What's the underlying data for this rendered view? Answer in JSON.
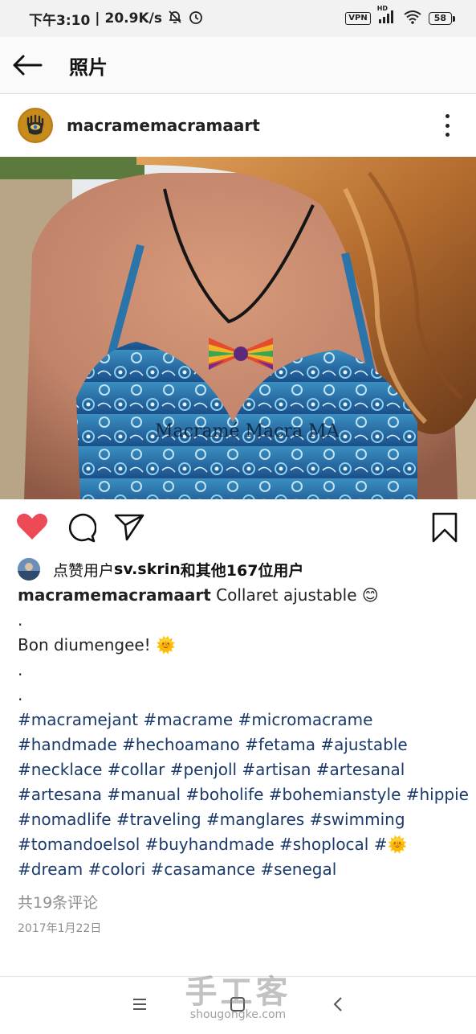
{
  "status_bar": {
    "time": "下午3:10",
    "network_speed": "20.9K/s",
    "vpn": "VPN",
    "hd": "HD",
    "battery": "58"
  },
  "app_bar": {
    "title": "照片"
  },
  "post": {
    "username": "macramemacramaart",
    "photo_watermark": "Macramé Macra MA",
    "likes": {
      "prefix": "点赞用户 ",
      "user": "sv.skrin",
      "mid": "和",
      "others": "其他167位用户"
    },
    "caption": {
      "user": "macramemacramaart",
      "text": " Collaret ajustable 😊",
      "line2": ".",
      "line3": "Bon diumengee! 🌞",
      "line4": ".",
      "line5": ".",
      "tag_lines": [
        "#macramejant #macrame #micromacrame",
        "#handmade #hechoamano #fetama #ajustable",
        "#necklace #collar #penjoll #artisan #artesanal",
        "#artesana #manual #boholife #bohemianstyle #hippie",
        "#nomadlife #traveling #manglares #swimming",
        "#tomandoelsol #buyhandmade #shoplocal #🌞",
        "#dream #colori #casamance #senegal"
      ]
    },
    "comments": "共19条评论",
    "date": "2017年1月22日"
  },
  "watermark": {
    "logo": "手工客",
    "url": "shougongke.com"
  },
  "colors": {
    "heart": "#ed4956",
    "hashtag": "#1b3a6b",
    "muted": "#8e8e8e"
  }
}
